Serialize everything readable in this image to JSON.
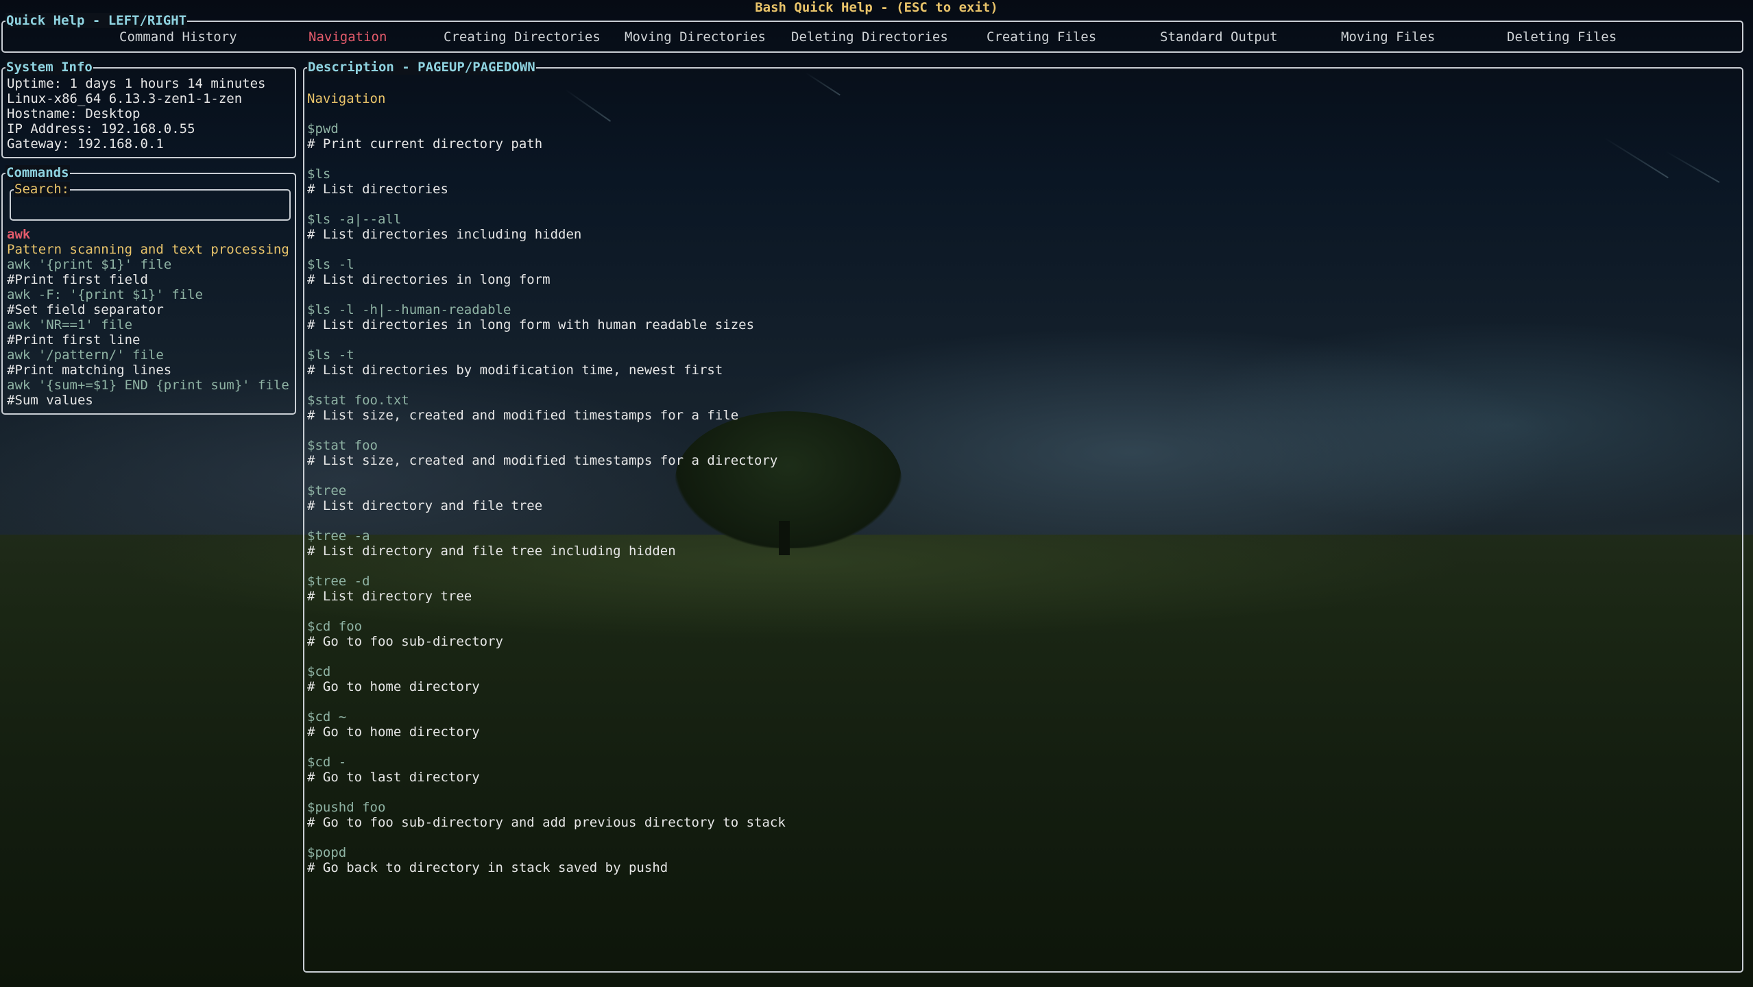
{
  "window_title": "Bash Quick Help - (ESC to exit)",
  "quick_help": {
    "label": "Quick Help - LEFT/RIGHT",
    "active_index": 1,
    "tabs": [
      "Command History",
      "Navigation",
      "Creating Directories",
      "Moving Directories",
      "Deleting Directories",
      "Creating Files",
      "Standard Output",
      "Moving Files",
      "Deleting Files"
    ]
  },
  "system_info": {
    "label": "System Info",
    "lines": [
      "Uptime: 1 days 1 hours 14 minutes",
      "Linux-x86_64 6.13.3-zen1-1-zen",
      "Hostname: Desktop",
      "IP Address: 192.168.0.55",
      "Gateway: 192.168.0.1"
    ]
  },
  "commands": {
    "label": "Commands",
    "search_label": "Search:",
    "search_value": "",
    "name": "awk",
    "description": "Pattern scanning and text processing",
    "examples": [
      {
        "code": "awk '{print $1}' file",
        "comment": "#Print first field"
      },
      {
        "code": "awk -F: '{print $1}' file",
        "comment": "#Set field separator"
      },
      {
        "code": "awk 'NR==1' file",
        "comment": "#Print first line"
      },
      {
        "code": "awk '/pattern/' file",
        "comment": "#Print matching lines"
      },
      {
        "code": "awk '{sum+=$1} END {print sum}' file",
        "comment": "#Sum values"
      }
    ]
  },
  "description": {
    "label": "Description - PAGEUP/PAGEDOWN",
    "title": "Navigation",
    "entries": [
      {
        "cmd": "$pwd",
        "comment": "# Print current directory path"
      },
      {
        "cmd": "$ls",
        "comment": "# List directories"
      },
      {
        "cmd": "$ls -a|--all",
        "comment": "# List directories including hidden"
      },
      {
        "cmd": "$ls -l",
        "comment": "# List directories in long form"
      },
      {
        "cmd": "$ls -l -h|--human-readable",
        "comment": "# List directories in long form with human readable sizes"
      },
      {
        "cmd": "$ls -t",
        "comment": "# List directories by modification time, newest first"
      },
      {
        "cmd": "$stat foo.txt",
        "comment": "# List size, created and modified timestamps for a file"
      },
      {
        "cmd": "$stat foo",
        "comment": "# List size, created and modified timestamps for a directory"
      },
      {
        "cmd": "$tree",
        "comment": "# List directory and file tree"
      },
      {
        "cmd": "$tree -a",
        "comment": "# List directory and file tree including hidden"
      },
      {
        "cmd": "$tree -d",
        "comment": "# List directory tree"
      },
      {
        "cmd": "$cd foo",
        "comment": "# Go to foo sub-directory"
      },
      {
        "cmd": "$cd",
        "comment": "# Go to home directory"
      },
      {
        "cmd": "$cd ~",
        "comment": "# Go to home directory"
      },
      {
        "cmd": "$cd -",
        "comment": "# Go to last directory"
      },
      {
        "cmd": "$pushd foo",
        "comment": "# Go to foo sub-directory and add previous directory to stack"
      },
      {
        "cmd": "$popd",
        "comment": "# Go back to directory in stack saved by pushd"
      }
    ]
  },
  "colors": {
    "title": "#e9c46a",
    "label": "#8fd3e0",
    "active_tab": "#e45b6b",
    "command": "#8fb3a4",
    "text": "#e6e6e6",
    "border": "#c9ced4"
  }
}
